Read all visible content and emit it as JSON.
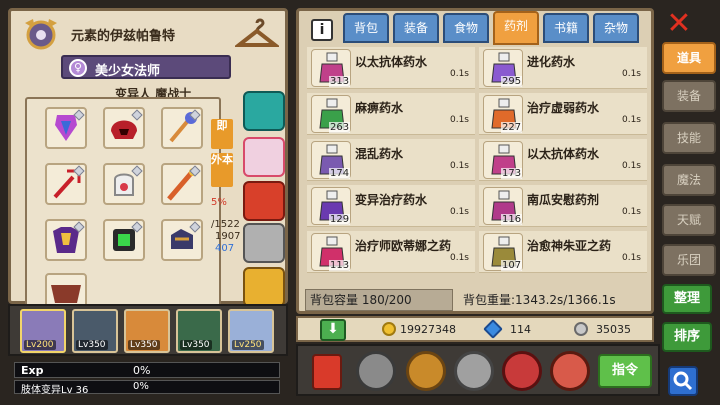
{
  "character": {
    "title": "元素的伊兹帕鲁特",
    "class_icon": "♀",
    "class_name": "美少女法师",
    "subtitle": "变异人 魔战士",
    "side_tags": [
      "即",
      "外本"
    ],
    "stats": [
      "5%",
      "/1522",
      "1907",
      "407"
    ]
  },
  "party": [
    {
      "level": "Lv200",
      "active": true
    },
    {
      "level": "Lv350",
      "active": false
    },
    {
      "level": "Lv350",
      "active": false
    },
    {
      "level": "Lv350",
      "active": false
    },
    {
      "level": "Lv250",
      "active": false
    }
  ],
  "exp": {
    "label": "Exp",
    "value": "0%"
  },
  "mutation": {
    "label": "肢体变异Lv 36",
    "value": "0%"
  },
  "inventory": {
    "info_label": "i",
    "tabs": [
      {
        "label": "背包",
        "active": false
      },
      {
        "label": "装备",
        "active": false
      },
      {
        "label": "食物",
        "active": false
      },
      {
        "label": "药剂",
        "active": true
      },
      {
        "label": "书籍",
        "active": false
      },
      {
        "label": "杂物",
        "active": false
      }
    ],
    "items": [
      {
        "name": "以太抗体药水",
        "count": "313",
        "weight": "0.1s",
        "color": "#c0408a"
      },
      {
        "name": "进化药水",
        "count": "295",
        "weight": "0.1s",
        "color": "#8a5ad0"
      },
      {
        "name": "麻痹药水",
        "count": "263",
        "weight": "0.1s",
        "color": "#3aa04a"
      },
      {
        "name": "治疗虚弱药水",
        "count": "227",
        "weight": "0.1s",
        "color": "#e06a2a"
      },
      {
        "name": "混乱药水",
        "count": "174",
        "weight": "0.1s",
        "color": "#7a5ab0"
      },
      {
        "name": "以太抗体药水",
        "count": "173",
        "weight": "0.1s",
        "color": "#c0408a"
      },
      {
        "name": "变异治疗药水",
        "count": "129",
        "weight": "0.1s",
        "color": "#6a3ab0"
      },
      {
        "name": "南瓜安慰药剂",
        "count": "116",
        "weight": "0.1s",
        "color": "#b03a8a"
      },
      {
        "name": "治疗师欧蒂娜之药",
        "count": "113",
        "weight": "0.1s",
        "color": "#d0306a"
      },
      {
        "name": "治愈神朱亚之药",
        "count": "107",
        "weight": "0.1s",
        "color": "#9a8a3a"
      }
    ],
    "capacity": "背包容量 180/200",
    "weight": "背包重量:1343.2s/1366.1s"
  },
  "currency": {
    "gold": "19927348",
    "gems": "114",
    "silver": "35035"
  },
  "actions": {
    "command": "指令"
  },
  "side_menu": [
    {
      "label": "道具",
      "active": true
    },
    {
      "label": "装备",
      "active": false
    },
    {
      "label": "技能",
      "active": false
    },
    {
      "label": "魔法",
      "active": false
    },
    {
      "label": "天赋",
      "active": false
    },
    {
      "label": "乐团",
      "active": false
    }
  ],
  "buttons": {
    "sort": "整理",
    "order": "排序"
  },
  "colors": {
    "accent": "#f0a040",
    "tab_blue": "#5a8ec8",
    "close_red": "#e03020",
    "green": "#5fc04a"
  }
}
